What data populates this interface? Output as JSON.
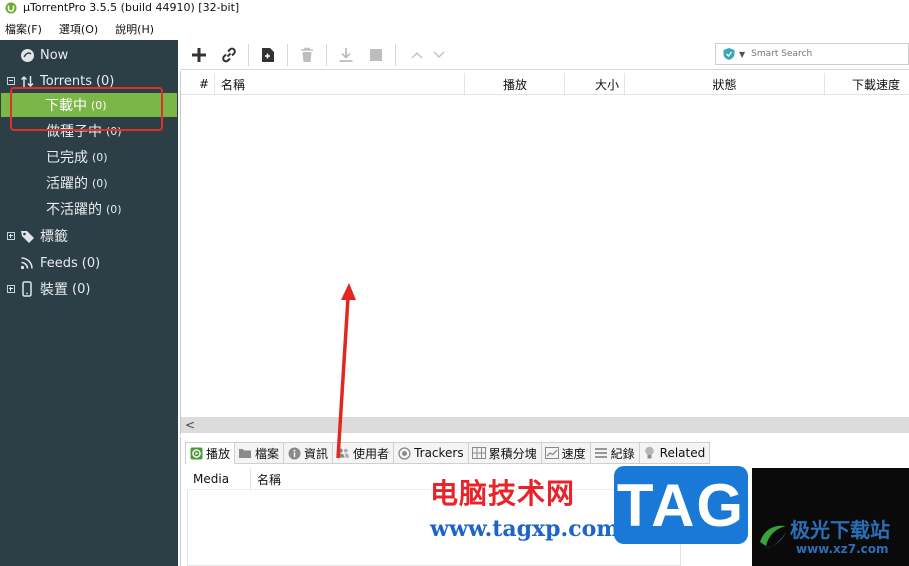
{
  "window": {
    "title": "µTorrentPro 3.5.5  (build 44910) [32-bit]"
  },
  "menu": [
    "檔案(F)",
    "選項(O)",
    "說明(H)"
  ],
  "sidebar": {
    "items": [
      {
        "label": "Now",
        "count": "",
        "icon": "now-icon"
      },
      {
        "label": "Torrents",
        "count": "(0)",
        "icon": "torrents-icon"
      },
      {
        "label": "下載中",
        "count": "(0)",
        "selected": true
      },
      {
        "label": "做種子中",
        "count": "(0)"
      },
      {
        "label": "已完成",
        "count": "(0)"
      },
      {
        "label": "活躍的",
        "count": "(0)"
      },
      {
        "label": "不活躍的",
        "count": "(0)"
      },
      {
        "label": "標籤",
        "count": "",
        "icon": "tag-icon"
      },
      {
        "label": "Feeds",
        "count": "(0)",
        "icon": "rss-icon"
      },
      {
        "label": "裝置",
        "count": "(0)",
        "icon": "device-icon"
      }
    ]
  },
  "search": {
    "placeholder": "Smart Search"
  },
  "list": {
    "columns": [
      "#",
      "名稱",
      "播放",
      "大小",
      "狀態",
      "下載速度"
    ]
  },
  "bottom": {
    "tabs": [
      "播放",
      "檔案",
      "資訊",
      "使用者",
      "Trackers",
      "累積分塊",
      "速度",
      "紀錄",
      "Related"
    ],
    "file_columns": [
      "Media",
      "名稱"
    ]
  },
  "watermarks": {
    "cn_site": "电脑技术网",
    "url": "www.tagxp.com",
    "tag": "TAG",
    "xz_cn": "极光下载站",
    "xz_url": "www.xz7.com"
  },
  "colors": {
    "sidebar_bg": "#2c3e46",
    "selected_green": "#7ab648",
    "highlight_red": "#e0302a"
  }
}
